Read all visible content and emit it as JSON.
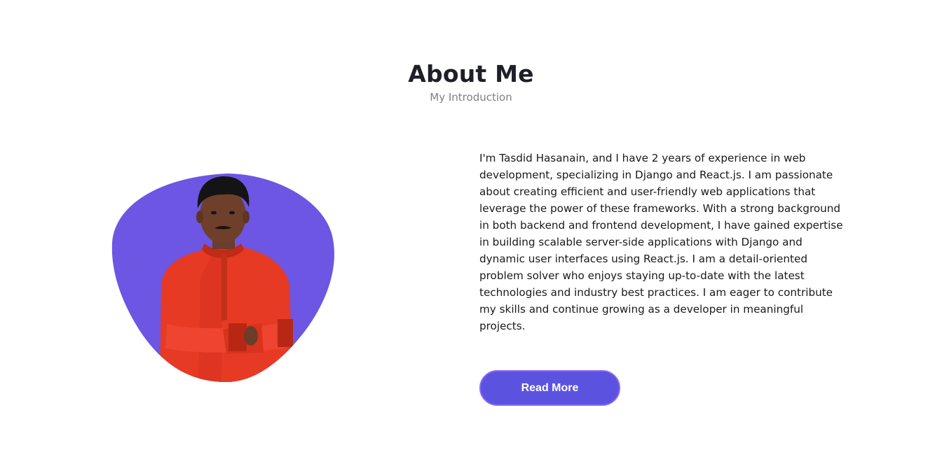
{
  "about": {
    "title": "About Me",
    "subtitle": "My Introduction",
    "description": "I'm Tasdid Hasanain, and I have 2 years of experience in web development, specializing in Django and React.js. I am passionate about creating efficient and user-friendly web applications that leverage the power of these frameworks. With a strong background in both backend and frontend development, I have gained expertise in building scalable server-side applications with Django and dynamic user interfaces using React.js. I am a detail-oriented problem solver who enjoys staying up-to-date with the latest technologies and industry best practices. I am eager to contribute my skills and continue growing as a developer in meaningful projects.",
    "read_more_label": "Read More"
  },
  "colors": {
    "blob": "#6c56e3",
    "button": "#5b53e0",
    "button_border": "#8a6cf0",
    "shirt": "#e63a25",
    "title": "#1f1f2a",
    "subtitle": "#808080"
  }
}
